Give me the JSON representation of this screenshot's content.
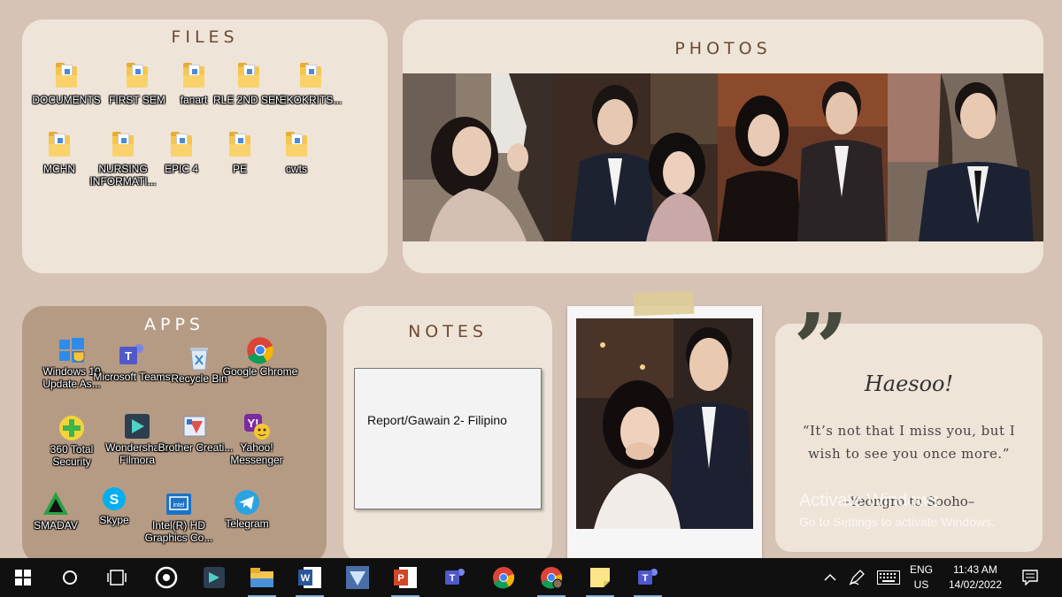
{
  "files": {
    "title": "FILES",
    "items": [
      {
        "label": "DOCUMENTS",
        "icon": "folder-icon"
      },
      {
        "label": "FIRST SEM",
        "icon": "folder-icon"
      },
      {
        "label": "fanart",
        "icon": "folder-icon"
      },
      {
        "label": "RLE 2ND SEM",
        "icon": "folder-icon"
      },
      {
        "label": "EKOKRITS...",
        "icon": "folder-icon"
      },
      {
        "label": "MCHN",
        "icon": "folder-icon"
      },
      {
        "label": "NURSING INFORMATI...",
        "icon": "folder-icon"
      },
      {
        "label": "EPIC 4",
        "icon": "folder-icon"
      },
      {
        "label": "PE",
        "icon": "folder-icon"
      },
      {
        "label": "cwts",
        "icon": "folder-icon"
      }
    ]
  },
  "photos": {
    "title": "PHOTOS"
  },
  "apps": {
    "title": "APPS",
    "items": [
      {
        "label": "Windows 10 Update As...",
        "icon": "windows-update-icon"
      },
      {
        "label": "Microsoft Teams",
        "icon": "teams-icon"
      },
      {
        "label": "Recycle Bin",
        "icon": "recycle-bin-icon"
      },
      {
        "label": "Google Chrome",
        "icon": "chrome-icon"
      },
      {
        "label": "360 Total Security",
        "icon": "security-icon"
      },
      {
        "label": "Wondershare Filmora",
        "icon": "filmora-icon"
      },
      {
        "label": "Brother Creati...",
        "icon": "brother-icon"
      },
      {
        "label": "Yahoo! Messenger",
        "icon": "yahoo-icon"
      },
      {
        "label": "SMADAV",
        "icon": "smadav-icon"
      },
      {
        "label": "Skype",
        "icon": "skype-icon"
      },
      {
        "label": "Intel(R) HD Graphics Co...",
        "icon": "intel-icon"
      },
      {
        "label": "Telegram",
        "icon": "telegram-icon"
      }
    ]
  },
  "notes": {
    "title": "NOTES",
    "note_text": "Report/Gawain 2- Filipino"
  },
  "quote": {
    "signature": "Haesoo!",
    "text": "“It’s not that I miss you, but I wish to see you once more.”",
    "author": "–Yeongro to Sooho–"
  },
  "activation": {
    "title": "Activate Windows",
    "subtitle": "Go to Settings to activate Windows."
  },
  "taskbar": {
    "language": "ENG",
    "region": "US",
    "time": "11:43 AM",
    "date": "14/02/2022"
  },
  "colors": {
    "background": "#d6c3b6",
    "panel": "#efe4d8",
    "apps_panel": "#b69b84",
    "title_text": "#6b4a33",
    "taskbar": "#101010"
  }
}
